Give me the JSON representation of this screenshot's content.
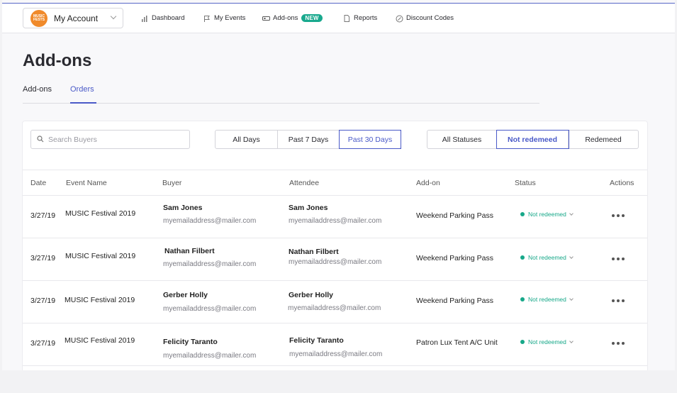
{
  "account": {
    "logo_line1": "MUSIC",
    "logo_line2": "FESTS",
    "label": "My Account"
  },
  "nav": [
    {
      "label": "Dashboard",
      "icon": "bar-chart-icon"
    },
    {
      "label": "My Events",
      "icon": "flag-icon"
    },
    {
      "label": "Add-ons",
      "icon": "ticket-icon",
      "badge": "NEW"
    },
    {
      "label": "Reports",
      "icon": "document-icon"
    },
    {
      "label": "Discount Codes",
      "icon": "discount-icon"
    }
  ],
  "page": {
    "title": "Add-ons"
  },
  "tabs": [
    {
      "label": "Add-ons"
    },
    {
      "label": "Orders",
      "active": true
    }
  ],
  "search": {
    "placeholder": "Search Buyers"
  },
  "day_filter": [
    {
      "label": "All Days"
    },
    {
      "label": "Past 7 Days"
    },
    {
      "label": "Past 30 Days",
      "active": true
    }
  ],
  "status_filter": [
    {
      "label": "All Statuses"
    },
    {
      "label": "Not redemeed",
      "active": true
    },
    {
      "label": "Redemeed"
    }
  ],
  "table": {
    "headers": [
      "Date",
      "Event Name",
      "Buyer",
      "Attendee",
      "Add-on",
      "Status",
      "Actions"
    ],
    "rows": [
      {
        "date": "3/27/19",
        "event": "MUSIC Festival 2019",
        "buyer_name": "Sam Jones",
        "buyer_email": "myemailaddress@mailer.com",
        "attendee_name": "Sam Jones",
        "attendee_email": "myemailaddress@mailer.com",
        "addon": "Weekend Parking Pass",
        "status": "Not redeemed"
      },
      {
        "date": "3/27/19",
        "event": "MUSIC Festival 2019",
        "buyer_name": "Nathan Filbert",
        "buyer_email": "myemailaddress@mailer.com",
        "attendee_name": "Nathan Filbert",
        "attendee_email": "myemailaddress@mailer.com",
        "addon": "Weekend Parking Pass",
        "status": "Not redeemed"
      },
      {
        "date": "3/27/19",
        "event": "MUSIC Festival 2019",
        "buyer_name": "Gerber Holly",
        "buyer_email": "myemailaddress@mailer.com",
        "attendee_name": "Gerber Holly",
        "attendee_email": "myemailaddress@mailer.com",
        "addon": "Weekend Parking Pass",
        "status": "Not redeemed"
      },
      {
        "date": "3/27/19",
        "event": "MUSIC Festival 2019",
        "buyer_name": "Felicity Taranto",
        "buyer_email": "myemailaddress@mailer.com",
        "attendee_name": "Felicity Taranto",
        "attendee_email": "myemailaddress@mailer.com",
        "addon": "Patron Lux Tent A/C Unit",
        "status": "Not redeemed"
      }
    ]
  },
  "colors": {
    "accent": "#4a5ac8",
    "status_green": "#17a889",
    "logo_orange": "#f08a2b",
    "badge_green": "#19a98e"
  }
}
